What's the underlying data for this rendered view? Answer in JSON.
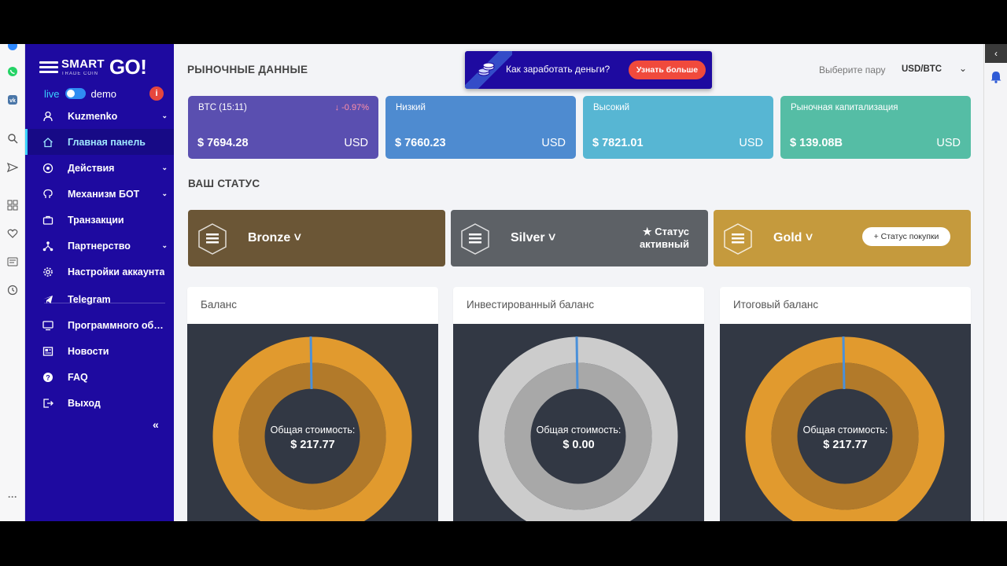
{
  "browser_strip": {
    "icons": [
      "messenger-icon",
      "whatsapp-icon",
      "vk-icon",
      "search-icon",
      "send-icon",
      "apps-icon",
      "heart-icon",
      "news-icon",
      "history-icon",
      "more-icon"
    ],
    "more_label": "···"
  },
  "sidebar": {
    "logo": {
      "smart": "SMART",
      "sub": "TRADE COIN",
      "go": "GO!"
    },
    "mode": {
      "live": "live",
      "demo": "demo",
      "info": "i"
    },
    "items": [
      {
        "label": "Kuzmenko",
        "icon": "user-icon",
        "chevron": true
      },
      {
        "label": "Главная панель",
        "icon": "home-icon",
        "active": true
      },
      {
        "label": "Действия",
        "icon": "coin-icon",
        "chevron": true
      },
      {
        "label": "Механизм БОТ",
        "icon": "brain-icon",
        "chevron": true
      },
      {
        "label": "Транзакции",
        "icon": "briefcase-icon"
      },
      {
        "label": "Партнерство",
        "icon": "network-icon",
        "chevron": true
      },
      {
        "label": "Настройки аккаунта",
        "icon": "gear-icon"
      },
      {
        "label": "Telegram",
        "icon": "telegram-icon"
      },
      {
        "label": "Программного обе...",
        "icon": "monitor-icon"
      },
      {
        "label": "Новости",
        "icon": "newspaper-icon"
      },
      {
        "label": "FAQ",
        "icon": "question-icon"
      },
      {
        "label": "Выход",
        "icon": "logout-icon"
      }
    ],
    "collapse_label": "«"
  },
  "header": {
    "title": "РЫНОЧНЫЕ ДАННЫЕ",
    "promo": {
      "text": "Как заработать деньги?",
      "button": "Узнать больше"
    },
    "pair_label": "Выберите пару",
    "pair_value": "USD/BTC",
    "pair_chevron": "⌄"
  },
  "stats": [
    {
      "label": "BTC (15:11)",
      "delta": "↓ -0.97%",
      "value": "$ 7694.28",
      "currency": "USD",
      "color": "#5a4fb0"
    },
    {
      "label": "Низкий",
      "value": "$ 7660.23",
      "currency": "USD",
      "color": "#4e8bd0"
    },
    {
      "label": "Высокий",
      "value": "$ 7821.01",
      "currency": "USD",
      "color": "#57b6d3"
    },
    {
      "label": "Рыночная капитализация",
      "value": "$ 139.08B",
      "currency": "USD",
      "color": "#55bda5"
    }
  ],
  "status": {
    "title": "ВАШ СТАТУС",
    "tiers": [
      {
        "name": "Bronze ˅",
        "color": "#6b5636"
      },
      {
        "name": "Silver ˅",
        "color": "#5d6166",
        "status_line1": "★ Статус",
        "status_line2": "активный"
      },
      {
        "name": "Gold ˅",
        "color": "#c59a3d",
        "button": "+ Статус покупки"
      }
    ]
  },
  "balances": [
    {
      "title": "Баланс",
      "total_label": "Общая стоимость:",
      "total_value": "$ 217.77",
      "outer_color": "#e19a2e",
      "inner_color": "#b27a2a"
    },
    {
      "title": "Инвестированный баланс",
      "total_label": "Общая стоимость:",
      "total_value": "$ 0.00",
      "outer_color": "#cccccc",
      "inner_color": "#a8a8a8"
    },
    {
      "title": "Итоговый баланс",
      "total_label": "Общая стоимость:",
      "total_value": "$ 217.77",
      "outer_color": "#e19a2e",
      "inner_color": "#b27a2a"
    }
  ],
  "right_strip": {
    "collapse_label": "‹"
  },
  "colors": {
    "sidebar": "#1e0aa0",
    "accent": "#3ad1ff",
    "promo_button": "#f04a3c"
  }
}
